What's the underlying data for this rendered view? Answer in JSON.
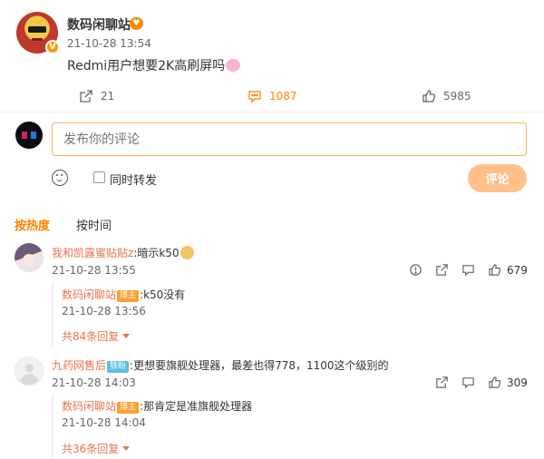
{
  "post": {
    "username": "数码闲聊站",
    "time": "21-10-28 13:54",
    "text": "Redmi用户想要2K高刷屏吗",
    "verify_badge": "V",
    "actions": {
      "repost_count": "21",
      "comment_count": "1087",
      "like_count": "5985"
    }
  },
  "composer": {
    "placeholder": "发布你的评论",
    "repost_label": "同时转发",
    "submit_label": "评论"
  },
  "sort_tabs": {
    "hot": "按热度",
    "time": "按时间"
  },
  "comments": [
    {
      "username": "我和凯露蜜贴贴z",
      "text": ":暗示k50",
      "time": "21-10-28 13:55",
      "like_count": "679",
      "reply": {
        "username": "数码闲聊站",
        "badge": "博主",
        "text": ":k50没有",
        "time": "21-10-28 13:56"
      },
      "more_replies": "共84条回复"
    },
    {
      "username": "九药网售后",
      "badge": "铁粉",
      "text": ":更想要旗舰处理器，最差也得778，1100这个级别的",
      "time": "21-10-28 14:03",
      "like_count": "309",
      "reply": {
        "username": "数码闲聊站",
        "badge": "博主",
        "text": ":那肯定是准旗舰处理器",
        "time": "21-10-28 14:04"
      },
      "more_replies": "共36条回复"
    }
  ],
  "colors": {
    "accent": "#ff8200",
    "username": "#eb7350",
    "submit_bg": "#ffc08a"
  }
}
